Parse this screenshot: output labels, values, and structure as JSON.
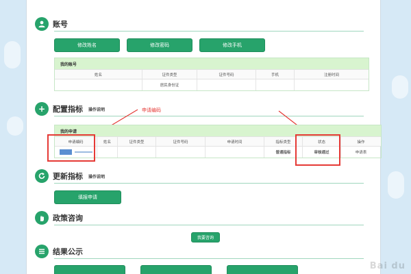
{
  "account": {
    "title": "账号",
    "buttons": [
      "修改姓名",
      "修改密码",
      "修改手机"
    ],
    "table_caption": "我的账号",
    "columns": [
      "姓名",
      "证件类型",
      "证件号码",
      "手机",
      "注册时间"
    ],
    "row": [
      "",
      "居民身份证",
      "",
      "",
      ""
    ]
  },
  "config": {
    "title": "配置指标",
    "help": "操作说明",
    "annotation": "申请编码",
    "table_caption": "我的申请",
    "columns": [
      "申请编码",
      "姓名",
      "证件类型",
      "证件号码",
      "申请时间",
      "指标类型",
      "状态",
      "操作"
    ],
    "row": {
      "code": "",
      "name": "",
      "id_type": "",
      "id_no": "",
      "apply_time": "",
      "type": "普通指标",
      "status": "审核通过",
      "action": "申请表"
    }
  },
  "update": {
    "title": "更新指标",
    "help": "操作说明",
    "button": "填报申请"
  },
  "policy": {
    "title": "政策咨询",
    "button": "我要咨询"
  },
  "result": {
    "title": "结果公示"
  },
  "colors": {
    "accent": "#27a36b",
    "annotation": "#e53935"
  }
}
